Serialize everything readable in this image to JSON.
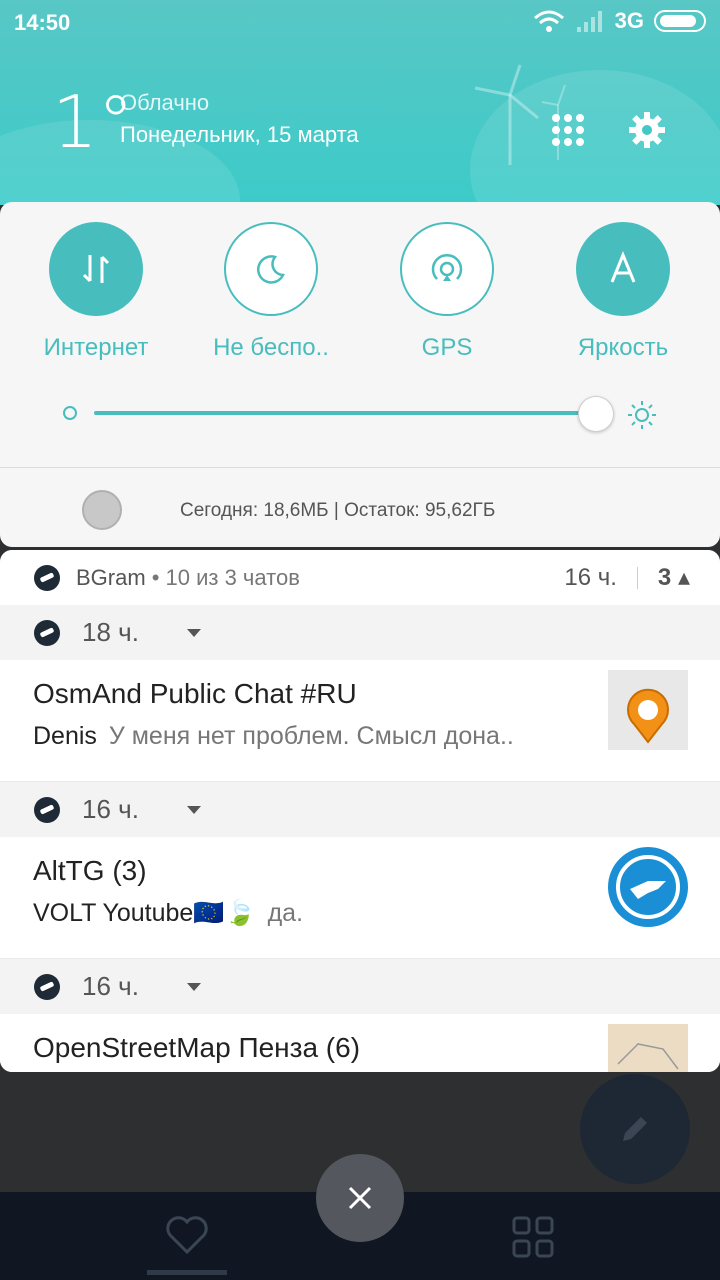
{
  "status_bar": {
    "time": "14:50",
    "network": "3G"
  },
  "weather": {
    "temperature": "1°",
    "condition": "Облачно",
    "date": "Понедельник, 15 марта"
  },
  "quick_settings": {
    "toggles": [
      {
        "label": "Интернет",
        "icon": "data-transfer-icon",
        "active": true
      },
      {
        "label": "Не беспо..",
        "icon": "moon-icon",
        "active": false
      },
      {
        "label": "GPS",
        "icon": "gps-icon",
        "active": false
      },
      {
        "label": "Яркость",
        "icon": "auto-brightness-icon",
        "active": true
      }
    ],
    "brightness_level": 0.96,
    "data_usage": "Сегодня: 18,6МБ  |  Остаток: 95,62ГБ"
  },
  "notification": {
    "app_name": "BGram",
    "summary": "• 10 из 3 чатов",
    "time": "16 ч.",
    "count": "3",
    "items": [
      {
        "time": "18 ч.",
        "title": "OsmAnd Public Chat #RU",
        "sender": "Denis",
        "text": "У меня нет проблем. Смысл дона..",
        "thumb": "osmand-logo-icon"
      },
      {
        "time": "16 ч.",
        "title": "AltTG (3)",
        "sender": "VOLT Youtube🇪🇺🍃",
        "text": "да.",
        "thumb": "alttg-logo-icon"
      },
      {
        "time": "16 ч.",
        "title": "OpenStreetMap Пенза (6)",
        "sender": "",
        "text": "",
        "thumb": "map-thumbnail-icon"
      }
    ]
  },
  "colors": {
    "accent": "#48bdbd",
    "header": "#3ccbc9"
  }
}
